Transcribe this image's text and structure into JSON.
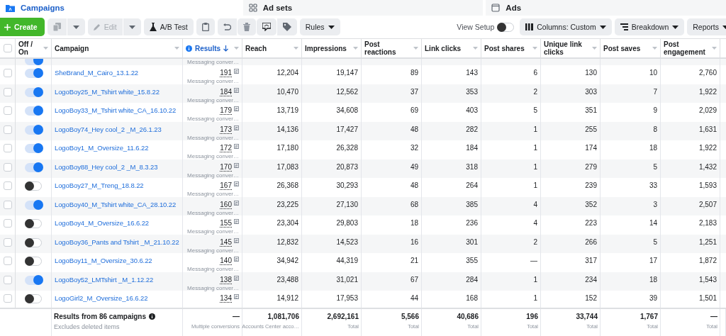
{
  "tabs": [
    {
      "label": "Campaigns",
      "selected": true
    },
    {
      "label": "Ad sets",
      "selected": false
    },
    {
      "label": "Ads",
      "selected": false
    }
  ],
  "toolbar": {
    "create": "Create",
    "copy_disabled": true,
    "edit": {
      "label": "Edit",
      "disabled": true
    },
    "ab_test": "A/B Test",
    "rules": "Rules",
    "view_setup": {
      "label": "View Setup",
      "on": false
    },
    "columns": "Columns: Custom",
    "breakdown": "Breakdown",
    "reports": "Reports"
  },
  "table": {
    "select_all_checked": false,
    "columns": [
      {
        "label": "Off / On",
        "sorted": false
      },
      {
        "label": "Campaign",
        "sorted": false
      },
      {
        "label": "Results",
        "sorted": true,
        "info": true
      },
      {
        "label": "Reach",
        "sorted": false
      },
      {
        "label": "Impressions",
        "sorted": false
      },
      {
        "label": "Post reactions",
        "sorted": false
      },
      {
        "label": "Link clicks",
        "sorted": false
      },
      {
        "label": "Post shares",
        "sorted": false
      },
      {
        "label": "Unique link clicks",
        "sorted": false
      },
      {
        "label": "Post saves",
        "sorted": false
      },
      {
        "label": "Post engagement",
        "sorted": false
      }
    ],
    "rows": [
      {
        "kind": "partial",
        "checked": false,
        "on": true,
        "results_label": "Messaging conver…"
      },
      {
        "kind": "full",
        "checked": false,
        "on": true,
        "campaign": "SheBrand_M_Cairo_13.1.22",
        "results": "191",
        "results_label": "Messaging conver…",
        "values": [
          "12,204",
          "19,147",
          "89",
          "143",
          "6",
          "130",
          "10",
          "2,760"
        ]
      },
      {
        "kind": "full",
        "checked": false,
        "on": true,
        "campaign": "LogoBoy25_M_Tshirt white_15.8.22",
        "results": "184",
        "results_label": "Messaging conver…",
        "values": [
          "10,470",
          "12,562",
          "37",
          "353",
          "2",
          "303",
          "7",
          "1,922"
        ]
      },
      {
        "kind": "full",
        "checked": false,
        "on": true,
        "campaign": "LogoBoy33_M_Tshirt white_CA_16.10.22",
        "results": "179",
        "results_label": "Messaging conver…",
        "values": [
          "13,719",
          "34,608",
          "69",
          "403",
          "5",
          "351",
          "9",
          "2,029"
        ]
      },
      {
        "kind": "full",
        "checked": false,
        "on": true,
        "campaign": "LogoBoy74_Hey cool_2 _M_26.1.23",
        "results": "173",
        "results_label": "Messaging conver…",
        "values": [
          "14,136",
          "17,427",
          "48",
          "282",
          "1",
          "255",
          "8",
          "1,631"
        ]
      },
      {
        "kind": "full",
        "checked": false,
        "on": true,
        "campaign": "LogoBoy1_M_Oversize_11.6.22",
        "results": "172",
        "results_label": "Messaging conver…",
        "values": [
          "17,180",
          "26,328",
          "32",
          "184",
          "1",
          "174",
          "18",
          "1,922"
        ]
      },
      {
        "kind": "full",
        "checked": false,
        "on": true,
        "campaign": "LogoBoy88_Hey cool_2 _M_8.3.23",
        "results": "170",
        "results_label": "Messaging conver…",
        "values": [
          "17,083",
          "20,873",
          "49",
          "318",
          "1",
          "279",
          "5",
          "1,432"
        ]
      },
      {
        "kind": "full",
        "checked": false,
        "on": false,
        "campaign": "LogoBoy27_M_Treng_18.8.22",
        "results": "167",
        "results_label": "Messaging conver…",
        "values": [
          "26,368",
          "30,293",
          "48",
          "264",
          "1",
          "239",
          "33",
          "1,593"
        ]
      },
      {
        "kind": "full",
        "checked": false,
        "on": true,
        "campaign": "LogoBoy40_M_Tshirt white_CA_28.10.22",
        "results": "160",
        "results_label": "Messaging conver…",
        "values": [
          "23,225",
          "27,130",
          "68",
          "385",
          "4",
          "352",
          "3",
          "2,507"
        ]
      },
      {
        "kind": "full",
        "checked": false,
        "on": false,
        "campaign": "LogoBoy4_M_Oversize_16.6.22",
        "results": "155",
        "results_label": "Messaging conver…",
        "values": [
          "23,304",
          "29,803",
          "18",
          "236",
          "4",
          "223",
          "14",
          "2,183"
        ]
      },
      {
        "kind": "full",
        "checked": false,
        "on": false,
        "campaign": "LogoBoy36_Pants and Tshirt _M_21.10.22",
        "results": "145",
        "results_label": "Messaging conver…",
        "values": [
          "12,832",
          "14,523",
          "16",
          "301",
          "2",
          "266",
          "5",
          "1,251"
        ]
      },
      {
        "kind": "full",
        "checked": false,
        "on": false,
        "campaign": "LogoBoy11_M_Oversize_30.6.22",
        "results": "140",
        "results_label": "Messaging conver…",
        "values": [
          "34,942",
          "44,319",
          "21",
          "355",
          "—",
          "317",
          "17",
          "1,872"
        ]
      },
      {
        "kind": "full",
        "checked": false,
        "on": true,
        "campaign": "LogoBoy52_LMTshirt _M_1.12.22",
        "results": "138",
        "results_label": "Messaging conver…",
        "values": [
          "23,488",
          "31,021",
          "67",
          "284",
          "1",
          "234",
          "18",
          "1,543"
        ]
      },
      {
        "kind": "full",
        "checked": false,
        "on": false,
        "campaign": "LogoGirl2_M_Oversize_16.6.22",
        "results": "134",
        "values": [
          "14,912",
          "17,953",
          "44",
          "168",
          "1",
          "152",
          "39",
          "1,501"
        ]
      }
    ],
    "footer": {
      "title": "Results from 86 campaigns",
      "subtitle": "Excludes deleted items",
      "cells": [
        {
          "value": "—",
          "label": "Multiple conversions"
        },
        {
          "value": "1,081,706",
          "label": "Accounts Center acco…"
        },
        {
          "value": "2,692,161",
          "label": "Total"
        },
        {
          "value": "5,566",
          "label": "Total"
        },
        {
          "value": "40,686",
          "label": "Total"
        },
        {
          "value": "196",
          "label": "Total"
        },
        {
          "value": "33,744",
          "label": "Total"
        },
        {
          "value": "1,767",
          "label": "Total"
        },
        {
          "value": "—",
          "label": "Total"
        }
      ]
    }
  }
}
